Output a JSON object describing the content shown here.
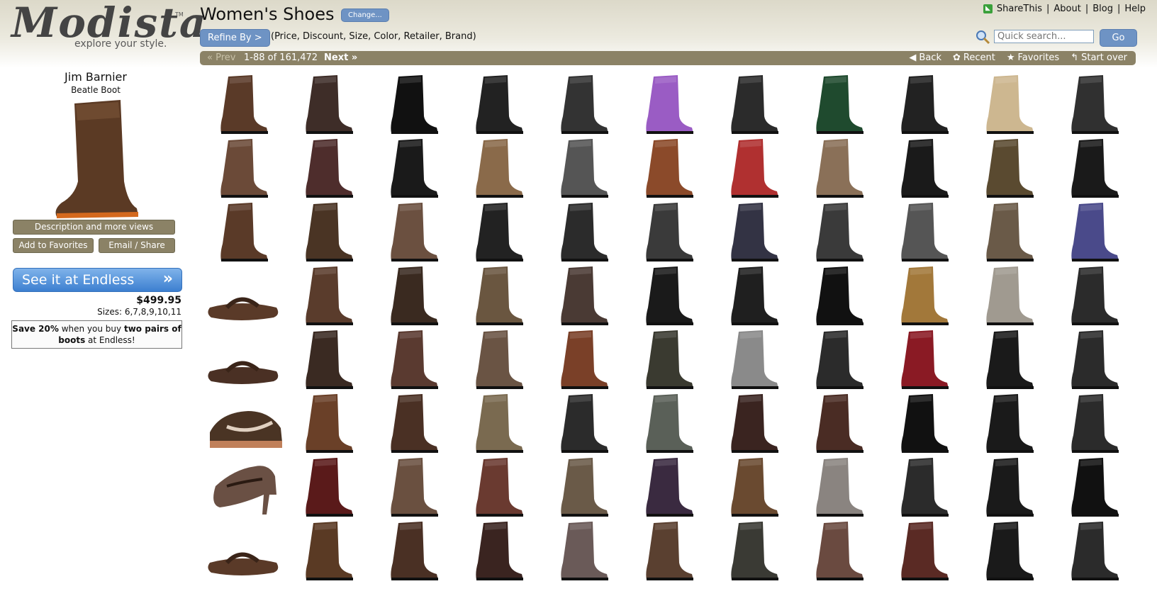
{
  "header": {
    "logo": {
      "word": "Modista",
      "tm": "TM",
      "tagline": "explore your style."
    },
    "title": "Women's Shoes",
    "change_label": "Change...",
    "refine_label": "Refine By >",
    "refine_hint": "(Price, Discount, Size, Color, Retailer, Brand)",
    "links": [
      "ShareThis",
      "About",
      "Blog",
      "Help"
    ],
    "search": {
      "placeholder": "Quick search...",
      "go_label": "Go"
    }
  },
  "nav": {
    "prev": "« Prev",
    "range": "1-88 of 161,472",
    "next": "Next »",
    "back": "Back",
    "recent": "Recent",
    "favorites": "Favorites",
    "start_over": "Start over",
    "back_icon": "back-arrow-icon",
    "recent_icon": "recent-icon",
    "favorites_icon": "star-icon",
    "start_over_icon": "start-over-icon"
  },
  "sidebar": {
    "brand": "Jim Barnier",
    "product": "Beatle Boot",
    "description_label": "Description and more views",
    "add_favorites_label": "Add to Favorites",
    "email_share_label": "Email / Share",
    "see_it_label": "See it at Endless",
    "price": "$499.95",
    "sizes": "Sizes: 6,7,8,9,10,11",
    "promo": {
      "p1": "Save 20%",
      "p2": " when you buy ",
      "p3": "two pairs of boots",
      "p4": " at Endless!"
    },
    "hero_color": "#5b3a24"
  },
  "colors": {
    "accent": "#6e93c4",
    "bar": "#8b8266"
  },
  "grid": {
    "columns": 11,
    "rows": 8,
    "items": [
      {
        "type": "boot",
        "color": "#5a3a28"
      },
      {
        "type": "boot",
        "color": "#3e2d28"
      },
      {
        "type": "boot",
        "color": "#111111"
      },
      {
        "type": "boot",
        "color": "#222222"
      },
      {
        "type": "boot",
        "color": "#333333"
      },
      {
        "type": "boot",
        "color": "#9a5cc4"
      },
      {
        "type": "boot",
        "color": "#2b2b2b"
      },
      {
        "type": "boot",
        "color": "#1f4a2e"
      },
      {
        "type": "boot",
        "color": "#222222"
      },
      {
        "type": "boot",
        "color": "#cdb790"
      },
      {
        "type": "boot",
        "color": "#303030"
      },
      {
        "type": "boot",
        "color": "#6b4a38"
      },
      {
        "type": "boot",
        "color": "#4e2d2c"
      },
      {
        "type": "boot",
        "color": "#1a1a1a"
      },
      {
        "type": "boot",
        "color": "#8a6a4a"
      },
      {
        "type": "boot",
        "color": "#555555"
      },
      {
        "type": "boot",
        "color": "#8b4a2a"
      },
      {
        "type": "boot",
        "color": "#b03030"
      },
      {
        "type": "boot",
        "color": "#8a7058"
      },
      {
        "type": "boot",
        "color": "#1a1a1a"
      },
      {
        "type": "boot",
        "color": "#5a4a30"
      },
      {
        "type": "boot",
        "color": "#1a1a1a"
      },
      {
        "type": "boot",
        "color": "#5a3a28"
      },
      {
        "type": "boot",
        "color": "#4a3424"
      },
      {
        "type": "boot",
        "color": "#6b5040"
      },
      {
        "type": "boot",
        "color": "#222222"
      },
      {
        "type": "boot",
        "color": "#2b2b2b"
      },
      {
        "type": "boot",
        "color": "#3a3a3a"
      },
      {
        "type": "boot",
        "color": "#333344"
      },
      {
        "type": "boot",
        "color": "#3a3a3a"
      },
      {
        "type": "boot",
        "color": "#555555"
      },
      {
        "type": "boot",
        "color": "#6a5a48"
      },
      {
        "type": "boot",
        "color": "#4a4a8a"
      },
      {
        "type": "sandal",
        "color": "#5a3a28"
      },
      {
        "type": "boot",
        "color": "#5a3c2c"
      },
      {
        "type": "boot",
        "color": "#3a2a20"
      },
      {
        "type": "boot",
        "color": "#6a5640"
      },
      {
        "type": "boot",
        "color": "#4a3a34"
      },
      {
        "type": "boot",
        "color": "#1a1a1a"
      },
      {
        "type": "boot",
        "color": "#1f1f1f"
      },
      {
        "type": "boot",
        "color": "#111111"
      },
      {
        "type": "boot",
        "color": "#a2783a"
      },
      {
        "type": "boot",
        "color": "#a09a90"
      },
      {
        "type": "boot",
        "color": "#2b2b2b"
      },
      {
        "type": "sandal",
        "color": "#4a3024"
      },
      {
        "type": "boot",
        "color": "#3a2a22"
      },
      {
        "type": "boot",
        "color": "#5a3a30"
      },
      {
        "type": "boot",
        "color": "#6a5444"
      },
      {
        "type": "boot",
        "color": "#7a4028"
      },
      {
        "type": "boot",
        "color": "#3a3a30"
      },
      {
        "type": "boot",
        "color": "#8a8a8a"
      },
      {
        "type": "boot",
        "color": "#2b2b2b"
      },
      {
        "type": "boot",
        "color": "#8a1a24"
      },
      {
        "type": "boot",
        "color": "#1a1a1a"
      },
      {
        "type": "boot",
        "color": "#2b2b2b"
      },
      {
        "type": "sneaker",
        "color": "#4a3424"
      },
      {
        "type": "boot",
        "color": "#6a4028"
      },
      {
        "type": "boot",
        "color": "#4a3024"
      },
      {
        "type": "boot",
        "color": "#7a6a50"
      },
      {
        "type": "boot",
        "color": "#2b2b2b"
      },
      {
        "type": "boot",
        "color": "#5a6058"
      },
      {
        "type": "boot",
        "color": "#3a2420"
      },
      {
        "type": "boot",
        "color": "#4a2c24"
      },
      {
        "type": "boot",
        "color": "#111111"
      },
      {
        "type": "boot",
        "color": "#1a1a1a"
      },
      {
        "type": "boot",
        "color": "#2b2b2b"
      },
      {
        "type": "heel",
        "color": "#6a5044"
      },
      {
        "type": "boot",
        "color": "#5a1a1a"
      },
      {
        "type": "boot",
        "color": "#6a5040"
      },
      {
        "type": "boot",
        "color": "#6a3a30"
      },
      {
        "type": "boot",
        "color": "#6a5a48"
      },
      {
        "type": "boot",
        "color": "#3a2a40"
      },
      {
        "type": "boot",
        "color": "#6a4a30"
      },
      {
        "type": "boot",
        "color": "#8a8480"
      },
      {
        "type": "boot",
        "color": "#2b2b2b"
      },
      {
        "type": "boot",
        "color": "#1a1a1a"
      },
      {
        "type": "boot",
        "color": "#111111"
      },
      {
        "type": "sandal",
        "color": "#5a3a28"
      },
      {
        "type": "boot",
        "color": "#5a3a24"
      },
      {
        "type": "boot",
        "color": "#4a3024"
      },
      {
        "type": "boot",
        "color": "#3a2420"
      },
      {
        "type": "boot",
        "color": "#6a5a58"
      },
      {
        "type": "boot",
        "color": "#5a4030"
      },
      {
        "type": "boot",
        "color": "#3a3a34"
      },
      {
        "type": "boot",
        "color": "#6a4a40"
      },
      {
        "type": "boot",
        "color": "#5a2a24"
      },
      {
        "type": "boot",
        "color": "#1a1a1a"
      },
      {
        "type": "boot",
        "color": "#2b2b2b"
      }
    ]
  }
}
